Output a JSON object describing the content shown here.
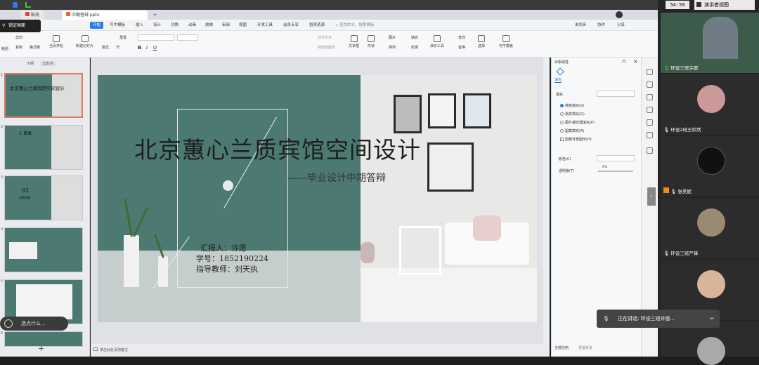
{
  "window": {
    "tab_docer": "稻壳",
    "tab_file": "中期答辩.pptx",
    "lock_label": "锁定画面",
    "tab_add": "+"
  },
  "menu": {
    "items": [
      "开始",
      "可牛模板",
      "插入",
      "设计",
      "切换",
      "动画",
      "放映",
      "审阅",
      "视图",
      "开发工具",
      "会员专享",
      "稻壳资源"
    ],
    "search": "查找命令、搜索模板",
    "sync": "未同步",
    "collab": "协作",
    "share": "分享"
  },
  "ribbon": {
    "paste": "粘贴",
    "cut": "剪切",
    "copy": "复制",
    "format_painter": "格式刷",
    "play_from_current": "当页开始",
    "new_slide": "新建幻灯片",
    "layout": "版式",
    "section": "节",
    "reset": "重置",
    "text_box": "文本框",
    "shape": "形状",
    "arrange": "排列",
    "outline": "轮廓",
    "presentation_tools": "演示工具",
    "find": "查找",
    "replace": "替换",
    "select": "选择",
    "template": "可牛模板",
    "picture": "图片",
    "fill": "填充",
    "align_text": "对齐文本",
    "convert_smartart": "转智能图形"
  },
  "left_pane": {
    "tab_outline": "大纲",
    "tab_slides": "幻灯片",
    "slide_numbers": [
      "1",
      "2",
      "3",
      "4",
      "5",
      "6"
    ],
    "add_label": "+"
  },
  "slide": {
    "title": "北京蕙心兰质宾馆空间设计",
    "subtitle": "——毕业设计中期答辩",
    "reporter": "汇报人：许愿",
    "student_id": "学号：1852190224",
    "advisor": "指导教师：刘天执"
  },
  "thumbnails": {
    "t1_title": "北京蕙心兰质宾馆空间设计",
    "t2_title": "C 目录",
    "t3_num": "01",
    "t3_label": "总图背景"
  },
  "notes": {
    "placeholder": "单击此处添加备注"
  },
  "properties": {
    "header": "对象属性",
    "tab_fill": "填充",
    "fill_label": "填充",
    "options": [
      "纯色填充(S)",
      "渐变填充(G)",
      "图片或纹理填充(P)",
      "图案填充(A)",
      "隐藏背景图形(H)"
    ],
    "color_label": "颜色(C)",
    "transparency_label": "透明度(T)",
    "transparency_value": "0%",
    "apply_all": "全部应用",
    "reset_bg": "重置背景"
  },
  "meeting": {
    "timer": "54:59",
    "view_mode": "演讲者视图",
    "participants": [
      {
        "name": "环设三班许愿"
      },
      {
        "name": "环设2班王欣然"
      },
      {
        "name": "张美妮"
      },
      {
        "name": "环设三班严锋"
      },
      {
        "name": ""
      },
      {
        "name": ""
      }
    ],
    "speaking": "正在讲话: 环设三班许愿...",
    "search_pill": "选点什么..."
  },
  "colors": {
    "accent": "#2a7de1",
    "slide_green": "#4c7a73",
    "selected_thumb": "#e07a5f"
  }
}
